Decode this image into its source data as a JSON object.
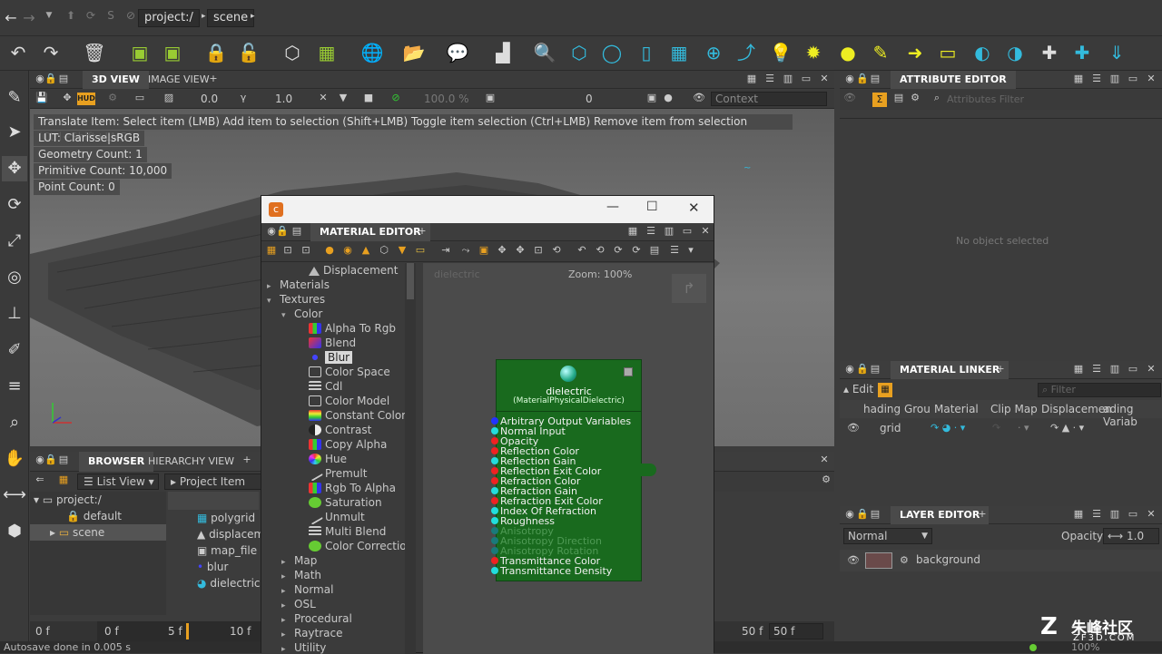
{
  "topbar": {
    "crumbs": [
      "project:/",
      "scene"
    ]
  },
  "viewport": {
    "tabs": [
      "3D VIEW",
      "IMAGE VIEW"
    ],
    "fields": {
      "v1": "0.0",
      "v2": "1.0",
      "zoom": "100.0 %",
      "frame": "0",
      "context": "Context"
    },
    "hint": "Translate Item: Select item (LMB)  Add item to selection (Shift+LMB)  Toggle item selection (Ctrl+LMB)  Remove item from selection (Ctrl+Shift+LMB)",
    "lut": "LUT: Clarisse|sRGB",
    "geometry": "Geometry Count: 1",
    "primitive": "Primitive Count: 10,000",
    "points": "Point Count: 0"
  },
  "material_editor": {
    "tab": "MATERIAL EDITOR",
    "graph_label": "dielectric",
    "zoom": "Zoom: 100%",
    "tree": [
      {
        "label": "Displacement",
        "indent": 2,
        "arrow": "",
        "icon": "tri"
      },
      {
        "label": "Materials",
        "indent": 0,
        "arrow": "▸",
        "icon": ""
      },
      {
        "label": "Textures",
        "indent": 0,
        "arrow": "▾",
        "icon": ""
      },
      {
        "label": "Color",
        "indent": 1,
        "arrow": "▾",
        "icon": ""
      },
      {
        "label": "Alpha To Rgb",
        "indent": 2,
        "arrow": "",
        "icon": "grid"
      },
      {
        "label": "Blend",
        "indent": 2,
        "arrow": "",
        "icon": "blend"
      },
      {
        "label": "Blur",
        "indent": 2,
        "arrow": "",
        "icon": "dot",
        "selected": true
      },
      {
        "label": "Color Space",
        "indent": 2,
        "arrow": "",
        "icon": "rect"
      },
      {
        "label": "Cdl",
        "indent": 2,
        "arrow": "",
        "icon": "list"
      },
      {
        "label": "Color Model",
        "indent": 2,
        "arrow": "",
        "icon": "rect"
      },
      {
        "label": "Constant Color",
        "indent": 2,
        "arrow": "",
        "icon": "rainbow"
      },
      {
        "label": "Contrast",
        "indent": 2,
        "arrow": "",
        "icon": "half"
      },
      {
        "label": "Copy Alpha",
        "indent": 2,
        "arrow": "",
        "icon": "grid"
      },
      {
        "label": "Hue",
        "indent": 2,
        "arrow": "",
        "icon": "hue"
      },
      {
        "label": "Premult",
        "indent": 2,
        "arrow": "",
        "icon": "wand"
      },
      {
        "label": "Rgb To Alpha",
        "indent": 2,
        "arrow": "",
        "icon": "grid"
      },
      {
        "label": "Saturation",
        "indent": 2,
        "arrow": "",
        "icon": "green"
      },
      {
        "label": "Unmult",
        "indent": 2,
        "arrow": "",
        "icon": "wand"
      },
      {
        "label": "Multi Blend",
        "indent": 2,
        "arrow": "",
        "icon": "list"
      },
      {
        "label": "Color Correction",
        "indent": 2,
        "arrow": "",
        "icon": "green"
      },
      {
        "label": "Map",
        "indent": 1,
        "arrow": "▸",
        "icon": ""
      },
      {
        "label": "Math",
        "indent": 1,
        "arrow": "▸",
        "icon": ""
      },
      {
        "label": "Normal",
        "indent": 1,
        "arrow": "▸",
        "icon": ""
      },
      {
        "label": "OSL",
        "indent": 1,
        "arrow": "▸",
        "icon": ""
      },
      {
        "label": "Procedural",
        "indent": 1,
        "arrow": "▸",
        "icon": ""
      },
      {
        "label": "Raytrace",
        "indent": 1,
        "arrow": "▸",
        "icon": ""
      },
      {
        "label": "Utility",
        "indent": 1,
        "arrow": "▸",
        "icon": ""
      }
    ],
    "node": {
      "title": "dielectric",
      "subtitle": "(MaterialPhysicalDielectric)",
      "ports": [
        {
          "label": "Arbitrary Output Variables",
          "color": "#2233ff",
          "dim": false
        },
        {
          "label": "Normal Input",
          "color": "#22dddd",
          "dim": false
        },
        {
          "label": "Opacity",
          "color": "#ee2222",
          "dim": false
        },
        {
          "label": "Reflection Color",
          "color": "#ee2222",
          "dim": false
        },
        {
          "label": "Reflection Gain",
          "color": "#22dddd",
          "dim": false
        },
        {
          "label": "Reflection Exit Color",
          "color": "#ee2222",
          "dim": false
        },
        {
          "label": "Refraction Color",
          "color": "#ee2222",
          "dim": false
        },
        {
          "label": "Refraction Gain",
          "color": "#22dddd",
          "dim": false
        },
        {
          "label": "Refraction Exit Color",
          "color": "#ee2222",
          "dim": false
        },
        {
          "label": "Index Of Refraction",
          "color": "#22dddd",
          "dim": false
        },
        {
          "label": "Roughness",
          "color": "#22dddd",
          "dim": false
        },
        {
          "label": "Anisotropy",
          "color": "#1a7a7a",
          "dim": true
        },
        {
          "label": "Anisotropy Direction",
          "color": "#1a7a7a",
          "dim": true
        },
        {
          "label": "Anisotropy Rotation",
          "color": "#1a7a7a",
          "dim": true
        },
        {
          "label": "Transmittance Color",
          "color": "#ee2222",
          "dim": false
        },
        {
          "label": "Transmittance Density",
          "color": "#22dddd",
          "dim": false
        }
      ]
    }
  },
  "attribute_editor": {
    "tab": "ATTRIBUTE EDITOR",
    "filter": "Attributes Filter",
    "empty": "No object selected"
  },
  "material_linker": {
    "tab": "MATERIAL LINKER",
    "edit": "Edit",
    "filter": "Filter",
    "columns": [
      "hading Grou",
      "Material",
      "Clip Map",
      "Displacemen",
      "ading Variab"
    ],
    "row": "grid"
  },
  "layer_editor": {
    "tab": "LAYER EDITOR",
    "mode": "Normal",
    "opacity_label": "Opacity",
    "opacity": "1.0",
    "layer": "background"
  },
  "browser": {
    "tabs": [
      "BROWSER",
      "HIERARCHY VIEW"
    ],
    "list_view": "List View",
    "project_item": "Project Item",
    "tree": [
      "project:/",
      "default",
      "scene"
    ],
    "items": [
      "polygrid",
      "displacem",
      "map_file",
      "blur",
      "dielectric"
    ]
  },
  "timeline": {
    "labels": [
      "0 f",
      "0 f",
      "5 f",
      "10 f",
      "50 f",
      "50 f"
    ]
  },
  "status": {
    "text": "Autosave done in 0.005 s",
    "zoom": "100%"
  },
  "watermark": {
    "cn": "朱峰社区",
    "url": "ZF3D.COM"
  }
}
